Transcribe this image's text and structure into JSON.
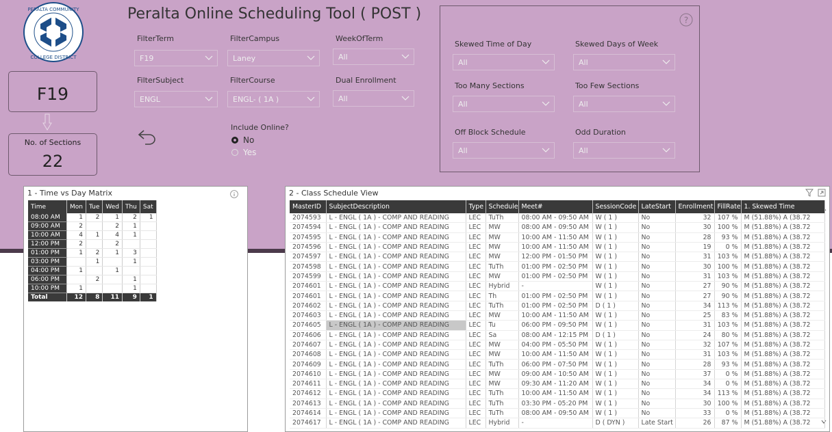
{
  "app": {
    "title": "Peralta Online Scheduling Tool ( POST )"
  },
  "logo": {
    "icon": "peralta-logo",
    "text_top": "PERALTA COMMUNITY",
    "text_bottom": "COLLEGE DISTRICT"
  },
  "cards": {
    "term_value": "F19",
    "sections_label": "No. of Sections",
    "sections_value": "22"
  },
  "filters": {
    "term": {
      "label": "FilterTerm",
      "value": "F19"
    },
    "campus": {
      "label": "FilterCampus",
      "value": "Laney"
    },
    "week": {
      "label": "WeekOfTerm",
      "value": "All"
    },
    "subject": {
      "label": "FilterSubject",
      "value": "ENGL"
    },
    "course": {
      "label": "FilterCourse",
      "value": "ENGL- ( 1A )"
    },
    "dual": {
      "label": "Dual Enrollment",
      "value": "All"
    },
    "online": {
      "label": "Include Online?",
      "options": [
        "No",
        "Yes"
      ],
      "selected": "No"
    }
  },
  "skew_filters": {
    "time_of_day": {
      "label": "Skewed Time of Day",
      "value": "All"
    },
    "days_of_week": {
      "label": "Skewed Days of Week",
      "value": "All"
    },
    "too_many": {
      "label": "Too Many Sections",
      "value": "All"
    },
    "too_few": {
      "label": "Too Few Sections",
      "value": "All"
    },
    "off_block": {
      "label": "Off Block Schedule",
      "value": "All"
    },
    "odd_duration": {
      "label": "Odd Duration",
      "value": "All"
    }
  },
  "matrix": {
    "title": "1 - Time vs Day Matrix",
    "columns": [
      "Time",
      "Mon",
      "Tue",
      "Wed",
      "Thu",
      "Sat"
    ],
    "rows": [
      [
        "08:00 AM",
        "1",
        "2",
        "1",
        "2",
        "1"
      ],
      [
        "09:00 AM",
        "2",
        "",
        "2",
        "1",
        ""
      ],
      [
        "10:00 AM",
        "4",
        "1",
        "4",
        "1",
        ""
      ],
      [
        "12:00 PM",
        "2",
        "",
        "2",
        "",
        ""
      ],
      [
        "01:00 PM",
        "1",
        "2",
        "1",
        "3",
        ""
      ],
      [
        "03:00 PM",
        "",
        "1",
        "",
        "1",
        ""
      ],
      [
        "04:00 PM",
        "1",
        "",
        "1",
        "",
        ""
      ],
      [
        "06:00 PM",
        "",
        "2",
        "",
        "1",
        ""
      ],
      [
        "10:00 PM",
        "1",
        "",
        "",
        "1",
        ""
      ]
    ],
    "total": [
      "Total",
      "12",
      "8",
      "11",
      "9",
      "1"
    ]
  },
  "schedule": {
    "title": "2 - Class Schedule View",
    "columns": [
      "MasterID",
      "SubjectDescription",
      "Type",
      "Schedule",
      "Meet#",
      "SessionCode",
      "LateStart",
      "Enrollment",
      "FillRate",
      "1. Skewed Time"
    ],
    "rows": [
      [
        "2074593",
        "L - ENGL ( 1A ) - COMP AND READING",
        "LEC",
        "TuTh",
        "08:00 AM - 09:50 AM",
        "W ( 1 )",
        "No",
        "32",
        "107 %",
        "M (51.88%) A (38.72"
      ],
      [
        "2074594",
        "L - ENGL ( 1A ) - COMP AND READING",
        "LEC",
        "MW",
        "08:00 AM - 09:50 AM",
        "W ( 1 )",
        "No",
        "30",
        "100 %",
        "M (51.88%) A (38.72"
      ],
      [
        "2074595",
        "L - ENGL ( 1A ) - COMP AND READING",
        "LEC",
        "MW",
        "10:00 AM - 11:50 AM",
        "W ( 1 )",
        "No",
        "28",
        "93 %",
        "M (51.88%) A (38.72"
      ],
      [
        "2074596",
        "L - ENGL ( 1A ) - COMP AND READING",
        "LEC",
        "MW",
        "10:00 AM - 11:50 AM",
        "W ( 1 )",
        "No",
        "19",
        "0 %",
        "M (51.88%) A (38.72"
      ],
      [
        "2074597",
        "L - ENGL ( 1A ) - COMP AND READING",
        "LEC",
        "MW",
        "12:00 PM - 01:50 PM",
        "W ( 1 )",
        "No",
        "31",
        "103 %",
        "M (51.88%) A (38.72"
      ],
      [
        "2074598",
        "L - ENGL ( 1A ) - COMP AND READING",
        "LEC",
        "TuTh",
        "01:00 PM - 02:50 PM",
        "W ( 1 )",
        "No",
        "30",
        "100 %",
        "M (51.88%) A (38.72"
      ],
      [
        "2074599",
        "L - ENGL ( 1A ) - COMP AND READING",
        "LEC",
        "MW",
        "01:00 PM - 02:50 PM",
        "W ( 1 )",
        "No",
        "31",
        "103 %",
        "M (51.88%) A (38.72"
      ],
      [
        "2074601",
        "L - ENGL ( 1A ) - COMP AND READING",
        "LEC",
        "Hybrid",
        "-",
        "W ( 1 )",
        "No",
        "27",
        "90 %",
        "M (51.88%) A (38.72"
      ],
      [
        "2074601",
        "L - ENGL ( 1A ) - COMP AND READING",
        "LEC",
        "Th",
        "01:00 PM - 02:50 PM",
        "W ( 1 )",
        "No",
        "27",
        "90 %",
        "M (51.88%) A (38.72"
      ],
      [
        "2074602",
        "L - ENGL ( 1A ) - COMP AND READING",
        "LEC",
        "TuTh",
        "01:00 PM - 02:50 PM",
        "D ( 1 )",
        "No",
        "34",
        "113 %",
        "M (51.88%) A (38.72"
      ],
      [
        "2074603",
        "L - ENGL ( 1A ) - COMP AND READING",
        "LEC",
        "MW",
        "10:00 AM - 11:50 AM",
        "W ( 1 )",
        "No",
        "25",
        "83 %",
        "M (51.88%) A (38.72"
      ],
      [
        "2074605",
        "L - ENGL ( 1A ) - COMP AND READING",
        "LEC",
        "Tu",
        "06:00 PM - 09:50 PM",
        "W ( 1 )",
        "No",
        "31",
        "103 %",
        "M (51.88%) A (38.72"
      ],
      [
        "2074606",
        "L - ENGL ( 1A ) - COMP AND READING",
        "LEC",
        "Sa",
        "08:00 AM - 12:15 PM",
        "D ( 1 )",
        "No",
        "24",
        "80 %",
        "M (51.88%) A (38.72"
      ],
      [
        "2074607",
        "L - ENGL ( 1A ) - COMP AND READING",
        "LEC",
        "MW",
        "04:00 PM - 05:50 PM",
        "W ( 1 )",
        "No",
        "32",
        "107 %",
        "M (51.88%) A (38.72"
      ],
      [
        "2074608",
        "L - ENGL ( 1A ) - COMP AND READING",
        "LEC",
        "MW",
        "10:00 AM - 11:50 AM",
        "W ( 1 )",
        "No",
        "31",
        "103 %",
        "M (51.88%) A (38.72"
      ],
      [
        "2074609",
        "L - ENGL ( 1A ) - COMP AND READING",
        "LEC",
        "TuTh",
        "06:00 PM - 07:50 PM",
        "W ( 1 )",
        "No",
        "28",
        "93 %",
        "M (51.88%) A (38.72"
      ],
      [
        "2074610",
        "L - ENGL ( 1A ) - COMP AND READING",
        "LEC",
        "MW",
        "09:00 AM - 10:50 AM",
        "W ( 1 )",
        "No",
        "37",
        "0 %",
        "M (51.88%) A (38.72"
      ],
      [
        "2074611",
        "L - ENGL ( 1A ) - COMP AND READING",
        "LEC",
        "MW",
        "09:30 AM - 11:20 AM",
        "W ( 1 )",
        "No",
        "34",
        "0 %",
        "M (51.88%) A (38.72"
      ],
      [
        "2074612",
        "L - ENGL ( 1A ) - COMP AND READING",
        "LEC",
        "TuTh",
        "10:00 AM - 11:50 AM",
        "W ( 1 )",
        "No",
        "34",
        "113 %",
        "M (51.88%) A (38.72"
      ],
      [
        "2074613",
        "L - ENGL ( 1A ) - COMP AND READING",
        "LEC",
        "TuTh",
        "03:30 PM - 05:20 PM",
        "W ( 1 )",
        "No",
        "30",
        "100 %",
        "M (51.88%) A (38.72"
      ],
      [
        "2074614",
        "L - ENGL ( 1A ) - COMP AND READING",
        "LEC",
        "TuTh",
        "08:00 AM - 09:50 AM",
        "W ( 1 )",
        "No",
        "33",
        "0 %",
        "M (51.88%) A (38.72"
      ],
      [
        "2074617",
        "L - ENGL ( 1A ) - COMP AND READING",
        "LEC",
        "Hybrid",
        "-",
        "D ( DYN )",
        "Late Start",
        "26",
        "87 %",
        "M (51.88%) A (38.72"
      ]
    ],
    "highlighted_row": "2074605"
  },
  "colors": {
    "background": "#c9a3c7",
    "dark_strip": "#4c3a4b",
    "table_header": "#3a3a3a"
  }
}
